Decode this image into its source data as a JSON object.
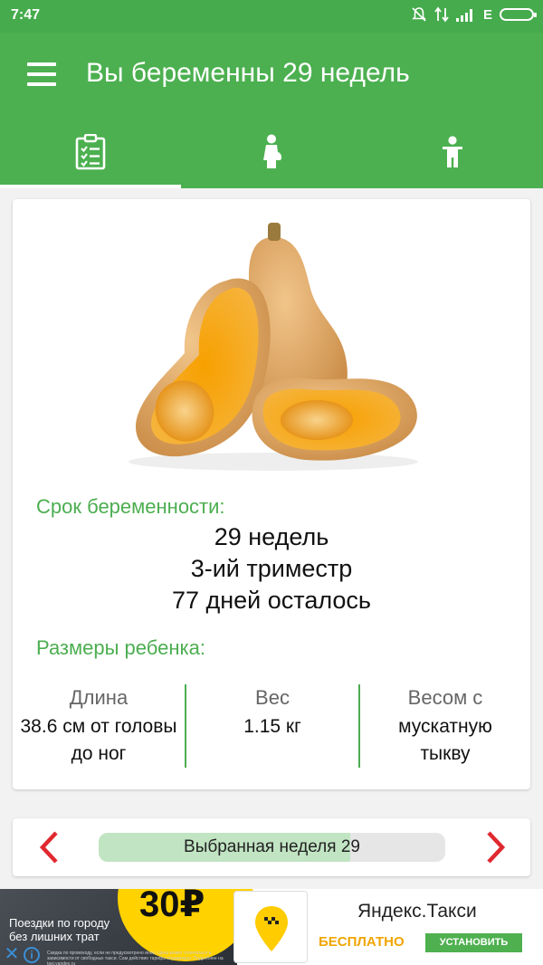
{
  "status_bar": {
    "time": "7:47",
    "network": "E"
  },
  "app_bar": {
    "title": "Вы беременны 29 недель"
  },
  "tabs": [
    {
      "icon": "checklist-icon",
      "active": true
    },
    {
      "icon": "pregnant-woman-icon",
      "active": false
    },
    {
      "icon": "child-icon",
      "active": false
    }
  ],
  "card": {
    "image": "butternut-squash-image",
    "term_label": "Срок беременности:",
    "weeks": "29 недель",
    "trimester": "3-ий триместр",
    "days_left": "77 дней осталось",
    "sizes_label": "Размеры ребенка:",
    "sizes": [
      {
        "head": "Длина",
        "value": "38.6 см от головы до ног"
      },
      {
        "head": "Вес",
        "value": "1.15 кг"
      },
      {
        "head": "Весом с",
        "value": "мускатную тыкву"
      }
    ]
  },
  "week_selector": {
    "label": "Выбранная неделя 29",
    "progress_fraction": 0.725,
    "prev_icon": "chevron-left-icon",
    "next_icon": "chevron-right-icon"
  },
  "ad": {
    "price": "30₽",
    "tagline": "Поездки по городу без лишних трат",
    "fine_print": "Скидка по промокоду, если не предусмотрено иное. Цена может отличаться в зависимости от свободных такси. Сам действие тарифа ограничено. Подробнее на taxi.yandex.ru",
    "brand": "Яндекс.Такси",
    "free": "БЕСПЛАТНО",
    "install": "УСТАНОВИТЬ"
  },
  "colors": {
    "primary": "#4cb050",
    "status_bar": "#45ab4c",
    "accent_red": "#e0282f",
    "label_green": "#4cae50"
  }
}
